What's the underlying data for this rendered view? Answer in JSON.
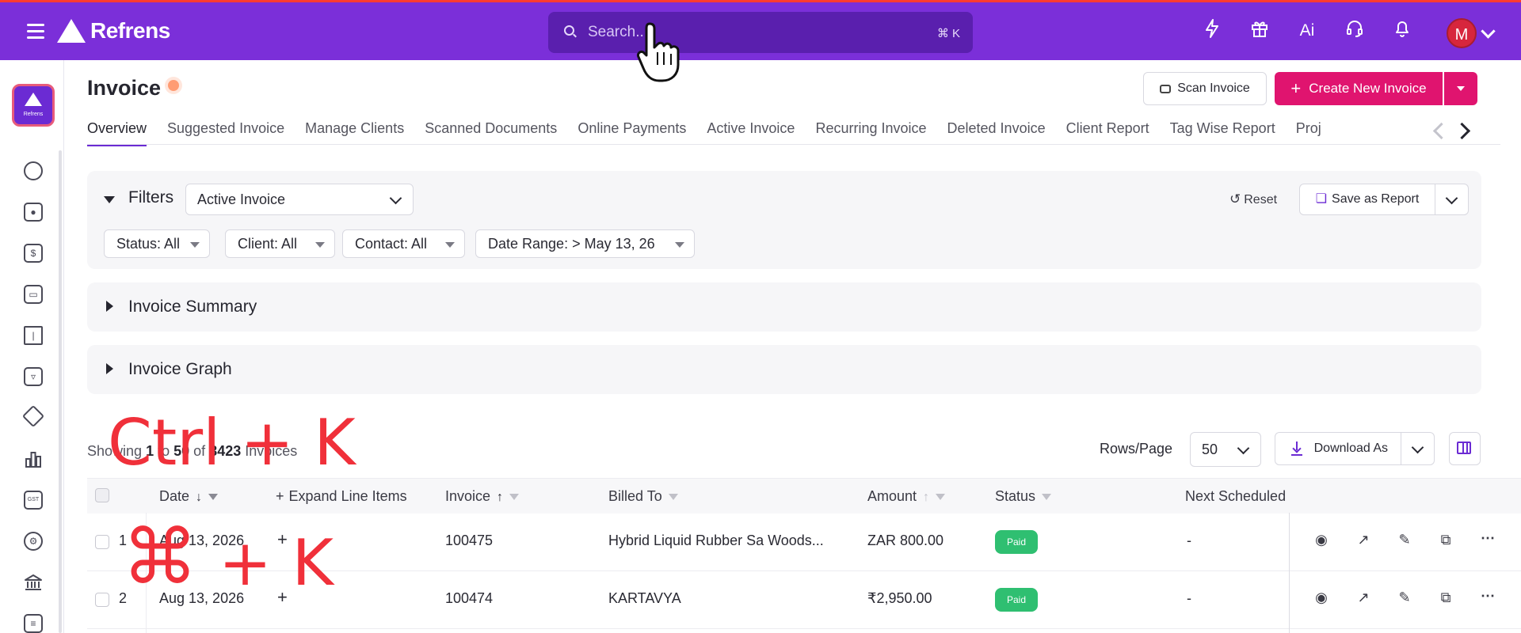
{
  "topbar": {
    "brand": "Refrens",
    "search_placeholder": "Search...",
    "search_shortcut": "⌘ K",
    "icons": [
      "lightning-icon",
      "gift-icon",
      "ai-icon",
      "support-headset-icon",
      "bell-icon"
    ],
    "avatar_letter": "M",
    "ai_label": "Ai"
  },
  "sidebar": {
    "badge_text": "Refrens",
    "items": [
      "dashboard-icon",
      "contacts-icon",
      "dollar-icon",
      "inbox-icon",
      "book-icon",
      "presentation-icon",
      "box-icon",
      "bar-chart-icon",
      "gst-icon",
      "settings-group-icon",
      "bank-icon",
      "document-icon"
    ],
    "gst_label": "GST"
  },
  "header": {
    "title": "Invoice",
    "scan_label": "Scan Invoice",
    "create_label": "Create New Invoice"
  },
  "tabs": [
    "Overview",
    "Suggested Invoice",
    "Manage Clients",
    "Scanned Documents",
    "Online Payments",
    "Active Invoice",
    "Recurring Invoice",
    "Deleted Invoice",
    "Client Report",
    "Tag Wise Report",
    "Proj"
  ],
  "filters": {
    "label": "Filters",
    "selected_view": "Active Invoice",
    "reset_label": "Reset",
    "save_label": "Save as Report",
    "pills": [
      "Status: All",
      "Client: All",
      "Contact: All",
      "Date Range: > May 13, 26"
    ]
  },
  "panels": {
    "summary": "Invoice Summary",
    "graph": "Invoice Graph"
  },
  "table_controls": {
    "showing_prefix": "Showing",
    "from": "1",
    "to_word": "to",
    "to": "50",
    "of_word": "of",
    "total": "3423",
    "suffix": "Invoices",
    "rows_label": "Rows/Page",
    "rows_value": "50",
    "download_label": "Download As"
  },
  "columns": {
    "date": "Date",
    "expand": "Expand Line Items",
    "invoice": "Invoice",
    "billed_to": "Billed To",
    "amount": "Amount",
    "status": "Status",
    "next": "Next Scheduled"
  },
  "rows": [
    {
      "num": "1",
      "date": "Aug 13, 2026",
      "invoice": "100475",
      "billed_to": "Hybrid Liquid Rubber Sa Woods...",
      "amount": "ZAR 800.00",
      "status": "Paid",
      "next": "-"
    },
    {
      "num": "2",
      "date": "Aug 13, 2026",
      "invoice": "100474",
      "billed_to": "KARTAVYA",
      "amount": "₹2,950.00",
      "status": "Paid",
      "next": "-"
    }
  ],
  "overlay": {
    "line1": "Ctrl + K",
    "line2_symbol": "⌘",
    "line2_text": "+ K"
  },
  "colors": {
    "topbar": "#7b2fd9",
    "primary_action": "#e0146f",
    "paid_badge": "#2fbf71",
    "overlay_text": "#f0303a"
  }
}
